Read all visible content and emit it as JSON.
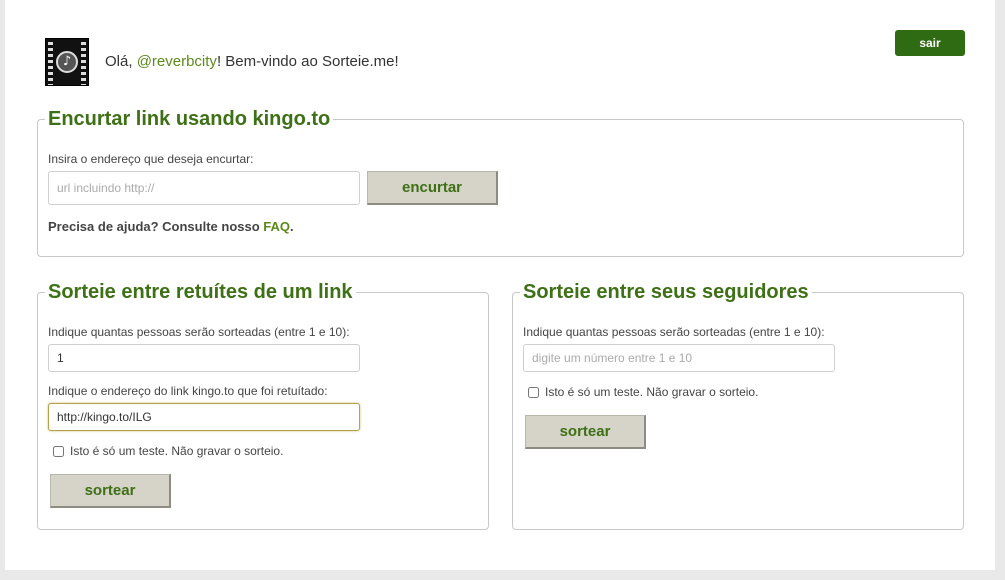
{
  "header": {
    "greeting_prefix": "Olá, ",
    "username": "@reverbcity",
    "greeting_suffix": "! Bem-vindo ao Sorteie.me!",
    "logout_label": "sair",
    "avatar_glyph": "♪"
  },
  "shorten": {
    "title": "Encurtar link usando kingo.to",
    "input_label": "Insira o endereço que deseja encurtar:",
    "input_placeholder": "url incluindo http://",
    "input_value": "",
    "button_label": "encurtar",
    "help_prefix": "Precisa de ajuda? Consulte nosso ",
    "help_link": "FAQ",
    "help_suffix": "."
  },
  "retweets": {
    "title": "Sorteie entre retuítes de um link",
    "count_label": "Indique quantas pessoas serão sorteadas (entre 1 e 10):",
    "count_value": "1",
    "link_label": "Indique o endereço do link kingo.to que foi retuítado:",
    "link_value": "http://kingo.to/ILG",
    "test_label": "Isto é só um teste. Não gravar o sorteio.",
    "button_label": "sortear"
  },
  "followers": {
    "title": "Sorteie entre seus seguidores",
    "count_label": "Indique quantas pessoas serão sorteadas (entre 1 e 10):",
    "count_placeholder": "digite um número entre 1 e 10",
    "count_value": "",
    "test_label": "Isto é só um teste. Não gravar o sorteio.",
    "button_label": "sortear"
  }
}
